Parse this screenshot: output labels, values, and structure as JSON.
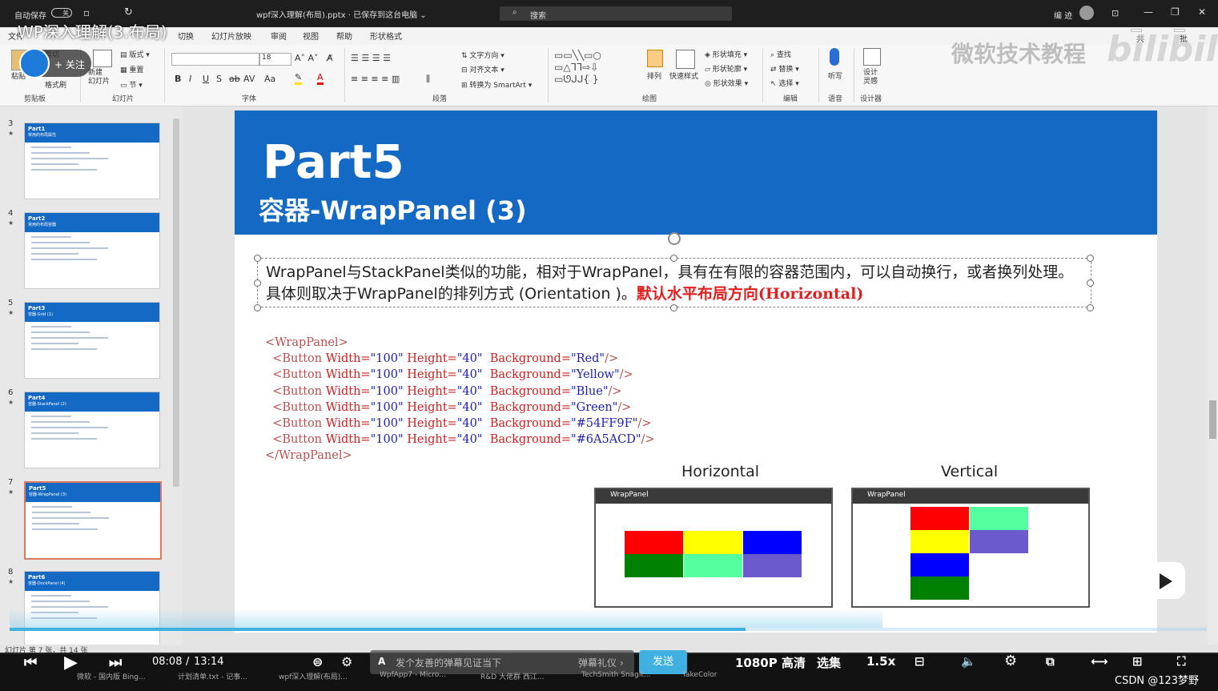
{
  "video": {
    "title": "WP深入理解(3.布局)",
    "follow_label": "+ 关注",
    "watermark": "微软技术教程",
    "bili_logo": "bilibili",
    "time_current": "08:08",
    "time_sep": "/",
    "time_total": "13:14",
    "progress": 0.615,
    "danmu_placeholder": "发个友善的弹幕见证当下",
    "danmu_etiquette": "弹幕礼仪 ›",
    "send_label": "发送",
    "quality": "1080P 高清",
    "episodes": "选集",
    "speed": "1.5x",
    "csdn": "CSDN @123梦野"
  },
  "window": {
    "autosave": "自动保存",
    "autosave_state": "关",
    "doc_title": "wpf深入理解(布局).pptx · 已保存到这台电脑 ⌄",
    "search": "搜索",
    "user": "编 迹",
    "share": "共享",
    "comments": "批注"
  },
  "ribbon": {
    "tabs": [
      "文件",
      "切换",
      "幻灯片放映",
      "审阅",
      "视图",
      "帮助",
      "形状格式"
    ],
    "groups": [
      "剪贴板",
      "幻灯片",
      "字体",
      "段落",
      "绘图",
      "编辑",
      "语音",
      "设计器"
    ],
    "paste": "粘贴",
    "cut": "剪切",
    "format_painter": "格式刷",
    "new_slide": "新建\n幻灯片",
    "layout": "版式",
    "reset": "重置",
    "section": "节",
    "font_size": "18",
    "text_direction": "文字方向",
    "align_text": "对齐文本",
    "convert_smartart": "转换为 SmartArt",
    "arrange": "排列",
    "quick_styles": "快速样式",
    "shape_fill": "形状填充",
    "shape_outline": "形状轮廓",
    "shape_effects": "形状效果",
    "find": "查找",
    "replace": "替换",
    "select": "选择",
    "dictate": "听写",
    "design_ideas": "设计\n灵感"
  },
  "thumbnails": [
    {
      "num": "3",
      "title": "Part1",
      "sub": "常用的布局属性"
    },
    {
      "num": "4",
      "title": "Part2",
      "sub": "常用的布局容器"
    },
    {
      "num": "5",
      "title": "Part3",
      "sub": "容器-Grid (1)"
    },
    {
      "num": "6",
      "title": "Part4",
      "sub": "容器-StackPanel (2)"
    },
    {
      "num": "7",
      "title": "Part5",
      "sub": "容器-WrapPanel (3)"
    },
    {
      "num": "8",
      "title": "Part6",
      "sub": "容器-DockPanel (4)"
    }
  ],
  "slide": {
    "title": "Part5",
    "subtitle": "容器-WrapPanel (3)",
    "para_main": "WrapPanel与StackPanel类似的功能，相对于WrapPanel，具有在有限的容器范围内，可以自动换行，或者换列处理。具体则取决于WrapPanel的排列方式 (Orientation )。",
    "para_red": "默认水平布局方向(Horizontal)",
    "code_open": "<WrapPanel>",
    "code_close": "</WrapPanel>",
    "code_lines": [
      {
        "w": "100",
        "h": "40",
        "bg": "Red"
      },
      {
        "w": "100",
        "h": "40",
        "bg": "Yellow"
      },
      {
        "w": "100",
        "h": "40",
        "bg": "Blue"
      },
      {
        "w": "100",
        "h": "40",
        "bg": "Green"
      },
      {
        "w": "100",
        "h": "40",
        "bg": "#54FF9F"
      },
      {
        "w": "100",
        "h": "40",
        "bg": "#6A5ACD"
      }
    ],
    "demo_horizontal_label": "Horizontal",
    "demo_vertical_label": "Vertical",
    "demo_window_title": "WrapPanel",
    "colors": [
      "#ff0000",
      "#ffff00",
      "#0000ff",
      "#008000",
      "#54ff9f",
      "#6a5acd"
    ]
  },
  "status": {
    "slide_info": "幻灯片 第 7 张，共 14 张"
  },
  "taskbar": [
    "微软 - 国内版 Bing...",
    "计划清单.txt - 记事...",
    "wpf深入理解(布局)...",
    "WpfApp7 - Micro...",
    "R&D 大佬群 西江...",
    "TechSmith Snagit...",
    "TakeColor"
  ]
}
